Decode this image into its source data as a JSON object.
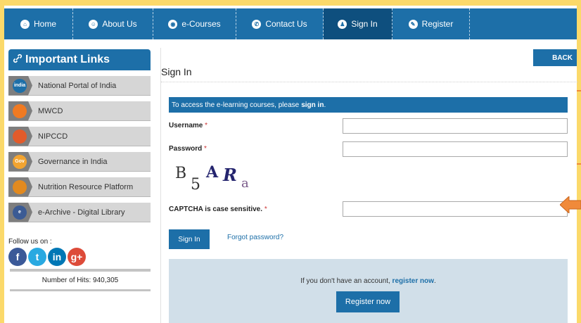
{
  "nav": {
    "items": [
      {
        "label": "Home",
        "icon": "home-icon",
        "glyph": "⌂"
      },
      {
        "label": "About Us",
        "icon": "users-icon",
        "glyph": "☺"
      },
      {
        "label": "e-Courses",
        "icon": "courses-icon",
        "glyph": "◉"
      },
      {
        "label": "Contact Us",
        "icon": "phone-icon",
        "glyph": "✆"
      },
      {
        "label": "Sign In",
        "icon": "user-icon",
        "glyph": "♟"
      },
      {
        "label": "Register",
        "icon": "register-icon",
        "glyph": "✎"
      }
    ],
    "active": "Sign In",
    "color": "#1d6fa8",
    "active_color": "#0e4f7e"
  },
  "sidebar": {
    "title": "Important Links",
    "title_icon": "link-icon",
    "links": [
      {
        "label": "National Portal of India",
        "icon": "india-logo-icon",
        "badge_text": "india",
        "badge_color": "#1d6fa8"
      },
      {
        "label": "MWCD",
        "icon": "mwcd-logo-icon",
        "badge_text": "",
        "badge_color": "#f07a22"
      },
      {
        "label": "NIPCCD",
        "icon": "nipccd-logo-icon",
        "badge_text": "",
        "badge_color": "#e25b2b"
      },
      {
        "label": "Governance in India",
        "icon": "gov-logo-icon",
        "badge_text": "Gov",
        "badge_color": "#f2a431"
      },
      {
        "label": "Nutrition Resource Platform",
        "icon": "nutrition-logo-icon",
        "badge_text": "",
        "badge_color": "#e28a1f"
      },
      {
        "label": "e-Archive - Digital Library",
        "icon": "archive-logo-icon",
        "badge_text": "e",
        "badge_color": "#3b5b94"
      }
    ],
    "follow_label": "Follow us on :",
    "social": [
      {
        "name": "facebook-icon",
        "glyph": "f",
        "color": "#3b5998"
      },
      {
        "name": "twitter-icon",
        "glyph": "t",
        "color": "#29a9e1"
      },
      {
        "name": "linkedin-icon",
        "glyph": "in",
        "color": "#0077b5"
      },
      {
        "name": "googleplus-icon",
        "glyph": "g+",
        "color": "#dd4b39"
      }
    ],
    "hits": "Number of Hits: 940,305"
  },
  "main": {
    "back_label": "BACK",
    "title": "Sign In",
    "info_text": "To access the e-learning courses, please",
    "info_link": "sign in",
    "info_end": ".",
    "username_label": "Username",
    "password_label": "Password",
    "required_mark": "*",
    "username_value": "",
    "password_value": "",
    "captcha_chars": [
      "B",
      "5",
      "A",
      "R",
      "a"
    ],
    "captcha_label": "CAPTCHA is case sensitive.",
    "captcha_value": "",
    "signin_label": "Sign In",
    "forgot_label": "Forgot password?",
    "register_prompt": "If you don't have an account,",
    "register_link": "register now",
    "register_end": ".",
    "register_button": "Register now"
  }
}
